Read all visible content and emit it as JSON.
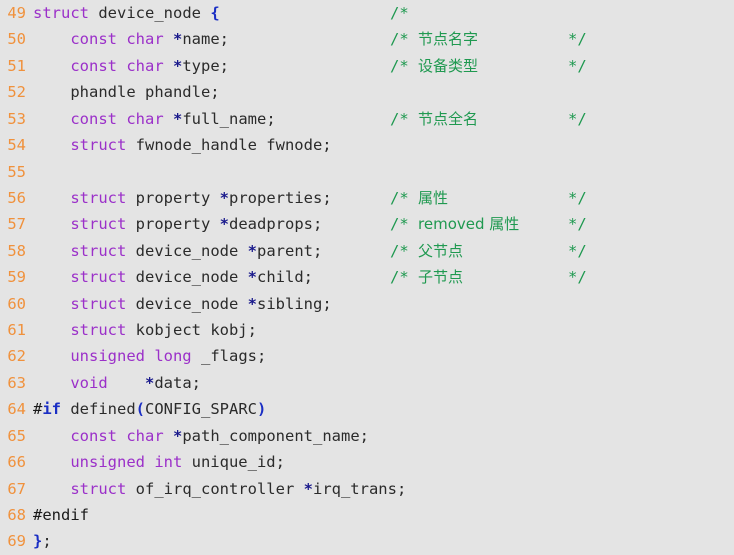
{
  "editor": {
    "background_color": "#e4e4e4",
    "line_number_color": "#f0913c",
    "keyword_color": "#9b30c9",
    "comment_color": "#1f9950",
    "pointer_color": "#1a1a8c",
    "brace_color": "#1a2ec4",
    "text_color": "#2b2b2b",
    "first_line_number": 49,
    "last_line_number": 69
  },
  "lines": [
    {
      "num": "49",
      "segments": [
        {
          "t": "struct",
          "c": "kw"
        },
        {
          "t": " device_node ",
          "c": "plain"
        },
        {
          "t": "{",
          "c": "brace"
        }
      ],
      "comment_open": "/*",
      "comment_text": "",
      "comment_close": ""
    },
    {
      "num": "50",
      "segments": [
        {
          "t": "    ",
          "c": "plain"
        },
        {
          "t": "const char",
          "c": "kw"
        },
        {
          "t": " ",
          "c": "plain"
        },
        {
          "t": "*",
          "c": "star"
        },
        {
          "t": "name;",
          "c": "plain"
        }
      ],
      "comment_open": "/*",
      "comment_text": "节点名字",
      "comment_close": "*/"
    },
    {
      "num": "51",
      "segments": [
        {
          "t": "    ",
          "c": "plain"
        },
        {
          "t": "const char",
          "c": "kw"
        },
        {
          "t": " ",
          "c": "plain"
        },
        {
          "t": "*",
          "c": "star"
        },
        {
          "t": "type;",
          "c": "plain"
        }
      ],
      "comment_open": "/*",
      "comment_text": "设备类型",
      "comment_close": "*/"
    },
    {
      "num": "52",
      "segments": [
        {
          "t": "    phandle phandle;",
          "c": "plain"
        }
      ],
      "comment_open": "",
      "comment_text": "",
      "comment_close": ""
    },
    {
      "num": "53",
      "segments": [
        {
          "t": "    ",
          "c": "plain"
        },
        {
          "t": "const char",
          "c": "kw"
        },
        {
          "t": " ",
          "c": "plain"
        },
        {
          "t": "*",
          "c": "star"
        },
        {
          "t": "full_name;",
          "c": "plain"
        }
      ],
      "comment_open": "/*",
      "comment_text": "节点全名",
      "comment_close": "*/"
    },
    {
      "num": "54",
      "segments": [
        {
          "t": "    ",
          "c": "plain"
        },
        {
          "t": "struct",
          "c": "kw"
        },
        {
          "t": " fwnode_handle fwnode;",
          "c": "plain"
        }
      ],
      "comment_open": "",
      "comment_text": "",
      "comment_close": ""
    },
    {
      "num": "55",
      "segments": [],
      "comment_open": "",
      "comment_text": "",
      "comment_close": ""
    },
    {
      "num": "56",
      "segments": [
        {
          "t": "    ",
          "c": "plain"
        },
        {
          "t": "struct",
          "c": "kw"
        },
        {
          "t": " property ",
          "c": "plain"
        },
        {
          "t": "*",
          "c": "star"
        },
        {
          "t": "properties;",
          "c": "plain"
        }
      ],
      "comment_open": "/*",
      "comment_text": "属性",
      "comment_close": "*/"
    },
    {
      "num": "57",
      "segments": [
        {
          "t": "    ",
          "c": "plain"
        },
        {
          "t": "struct",
          "c": "kw"
        },
        {
          "t": " property ",
          "c": "plain"
        },
        {
          "t": "*",
          "c": "star"
        },
        {
          "t": "deadprops;",
          "c": "plain"
        }
      ],
      "comment_open": "/*",
      "comment_text": "removed 属性",
      "comment_close": "*/"
    },
    {
      "num": "58",
      "segments": [
        {
          "t": "    ",
          "c": "plain"
        },
        {
          "t": "struct",
          "c": "kw"
        },
        {
          "t": " device_node ",
          "c": "plain"
        },
        {
          "t": "*",
          "c": "star"
        },
        {
          "t": "parent;",
          "c": "plain"
        }
      ],
      "comment_open": "/*",
      "comment_text": "父节点",
      "comment_close": "*/"
    },
    {
      "num": "59",
      "segments": [
        {
          "t": "    ",
          "c": "plain"
        },
        {
          "t": "struct",
          "c": "kw"
        },
        {
          "t": " device_node ",
          "c": "plain"
        },
        {
          "t": "*",
          "c": "star"
        },
        {
          "t": "child;",
          "c": "plain"
        }
      ],
      "comment_open": "/*",
      "comment_text": "子节点",
      "comment_close": "*/"
    },
    {
      "num": "60",
      "segments": [
        {
          "t": "    ",
          "c": "plain"
        },
        {
          "t": "struct",
          "c": "kw"
        },
        {
          "t": " device_node ",
          "c": "plain"
        },
        {
          "t": "*",
          "c": "star"
        },
        {
          "t": "sibling;",
          "c": "plain"
        }
      ],
      "comment_open": "",
      "comment_text": "",
      "comment_close": ""
    },
    {
      "num": "61",
      "segments": [
        {
          "t": "    ",
          "c": "plain"
        },
        {
          "t": "struct",
          "c": "kw"
        },
        {
          "t": " kobject kobj;",
          "c": "plain"
        }
      ],
      "comment_open": "",
      "comment_text": "",
      "comment_close": ""
    },
    {
      "num": "62",
      "segments": [
        {
          "t": "    ",
          "c": "plain"
        },
        {
          "t": "unsigned long",
          "c": "kw"
        },
        {
          "t": " _flags;",
          "c": "plain"
        }
      ],
      "comment_open": "",
      "comment_text": "",
      "comment_close": ""
    },
    {
      "num": "63",
      "segments": [
        {
          "t": "    ",
          "c": "plain"
        },
        {
          "t": "void",
          "c": "kw"
        },
        {
          "t": "    ",
          "c": "plain"
        },
        {
          "t": "*",
          "c": "star"
        },
        {
          "t": "data;",
          "c": "plain"
        }
      ],
      "comment_open": "",
      "comment_text": "",
      "comment_close": ""
    },
    {
      "num": "64",
      "segments": [
        {
          "t": "#",
          "c": "pp"
        },
        {
          "t": "if",
          "c": "ppkw"
        },
        {
          "t": " defined",
          "c": "plain"
        },
        {
          "t": "(",
          "c": "paren"
        },
        {
          "t": "CONFIG_SPARC",
          "c": "plain"
        },
        {
          "t": ")",
          "c": "paren"
        }
      ],
      "comment_open": "",
      "comment_text": "",
      "comment_close": ""
    },
    {
      "num": "65",
      "segments": [
        {
          "t": "    ",
          "c": "plain"
        },
        {
          "t": "const char",
          "c": "kw"
        },
        {
          "t": " ",
          "c": "plain"
        },
        {
          "t": "*",
          "c": "star"
        },
        {
          "t": "path_component_name;",
          "c": "plain"
        }
      ],
      "comment_open": "",
      "comment_text": "",
      "comment_close": ""
    },
    {
      "num": "66",
      "segments": [
        {
          "t": "    ",
          "c": "plain"
        },
        {
          "t": "unsigned int",
          "c": "kw"
        },
        {
          "t": " unique_id;",
          "c": "plain"
        }
      ],
      "comment_open": "",
      "comment_text": "",
      "comment_close": ""
    },
    {
      "num": "67",
      "segments": [
        {
          "t": "    ",
          "c": "plain"
        },
        {
          "t": "struct",
          "c": "kw"
        },
        {
          "t": " of_irq_controller ",
          "c": "plain"
        },
        {
          "t": "*",
          "c": "star"
        },
        {
          "t": "irq_trans;",
          "c": "plain"
        }
      ],
      "comment_open": "",
      "comment_text": "",
      "comment_close": ""
    },
    {
      "num": "68",
      "segments": [
        {
          "t": "#endif",
          "c": "pp"
        }
      ],
      "comment_open": "",
      "comment_text": "",
      "comment_close": ""
    },
    {
      "num": "69",
      "segments": [
        {
          "t": "}",
          "c": "brace"
        },
        {
          "t": ";",
          "c": "plain"
        }
      ],
      "comment_open": "",
      "comment_text": "",
      "comment_close": ""
    }
  ]
}
